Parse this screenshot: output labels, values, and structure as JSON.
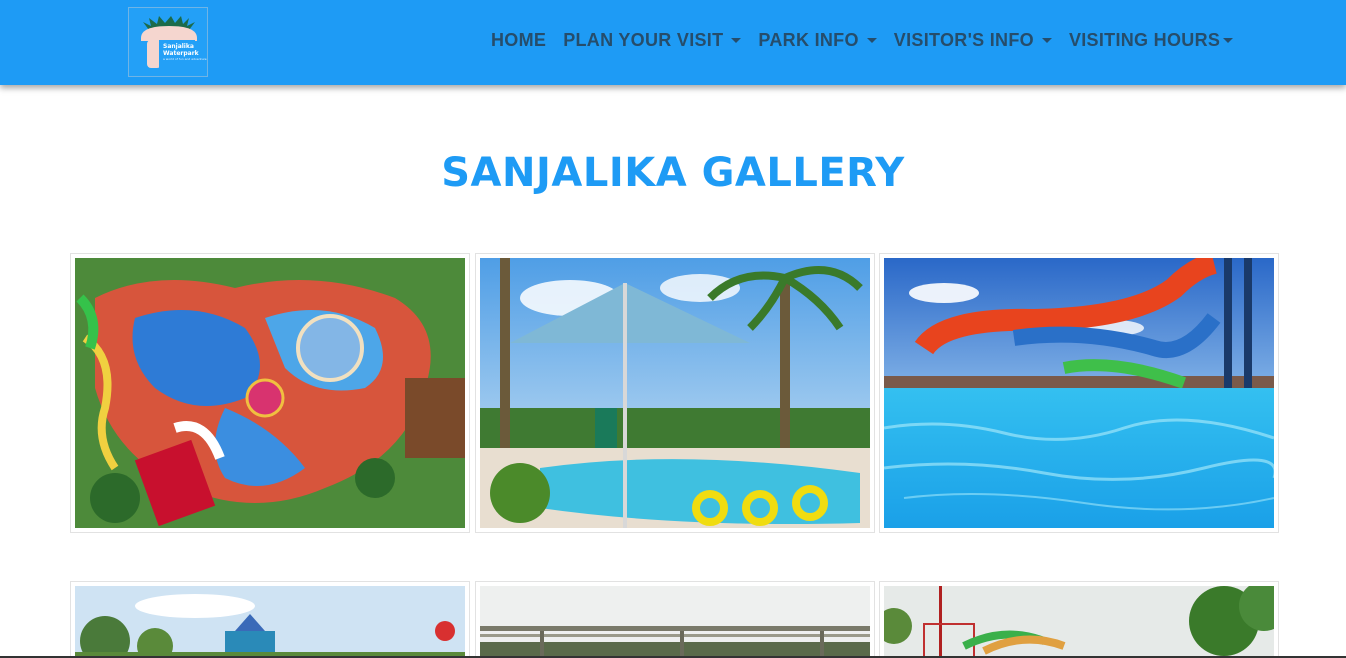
{
  "navbar": {
    "logo": {
      "name": "Sanjalika",
      "name2": "Waterpark",
      "tagline": "a world of fun and adventure"
    },
    "items": [
      {
        "label": "HOME",
        "dropdown": false
      },
      {
        "label": "PLAN YOUR VISIT",
        "dropdown": true
      },
      {
        "label": "PARK INFO",
        "dropdown": true
      },
      {
        "label": "VISITOR'S INFO",
        "dropdown": true
      },
      {
        "label": "VISITING HOURS",
        "dropdown": true
      }
    ]
  },
  "gallery": {
    "title": "SANJALIKA GALLERY"
  },
  "colors": {
    "accent": "#1e9bf5",
    "nav_text": "#264d6b"
  }
}
